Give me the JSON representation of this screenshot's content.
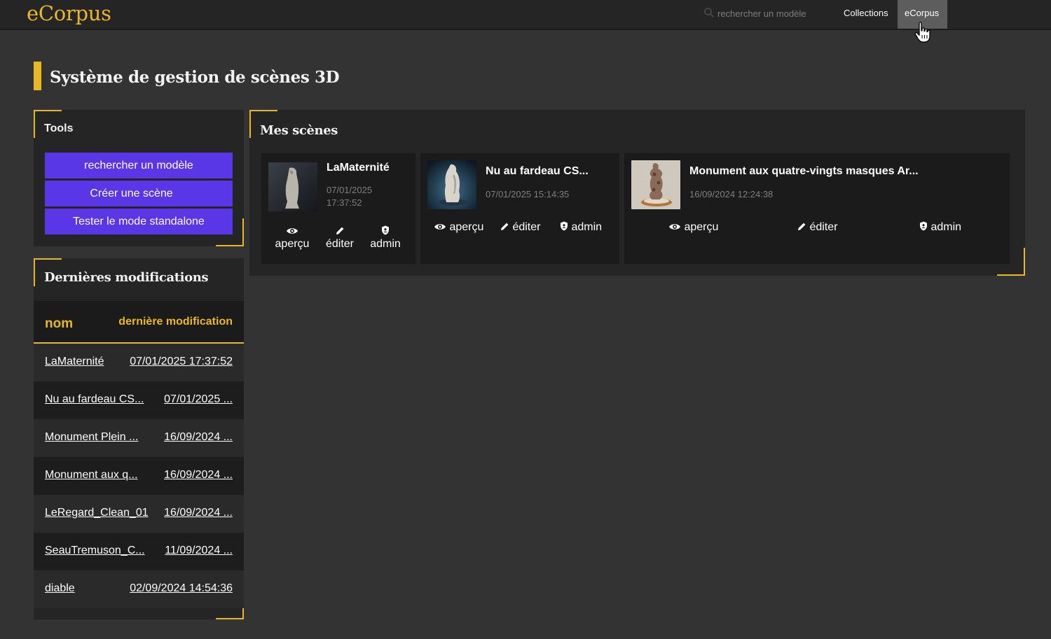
{
  "header": {
    "brand": "eCorpus",
    "search_placeholder": "rechercher un modèle",
    "nav": {
      "collections": "Collections",
      "ecorpus": "eCorpus"
    }
  },
  "page_title": "Système de gestion de scènes 3D",
  "tools": {
    "title": "Tools",
    "buttons": [
      "rechercher un modèle",
      "Créer une scène",
      "Tester le mode standalone"
    ]
  },
  "recent": {
    "title": "Dernières modifications",
    "col_name": "nom",
    "col_modified": "dernière modification",
    "rows": [
      {
        "name": "LaMaternité",
        "date": "07/01/2025 17:37:52"
      },
      {
        "name": "Nu au fardeau CS...",
        "date": "07/01/2025 ..."
      },
      {
        "name": "Monument Plein ...",
        "date": "16/09/2024 ..."
      },
      {
        "name": "Monument aux q...",
        "date": "16/09/2024 ..."
      },
      {
        "name": "LeRegard_Clean_01",
        "date": "16/09/2024 ..."
      },
      {
        "name": "SeauTremuson_C...",
        "date": "11/09/2024 ..."
      },
      {
        "name": "diable",
        "date": "02/09/2024 14:54:36"
      }
    ]
  },
  "scenes": {
    "title": "Mes scènes",
    "cards": [
      {
        "title": "LaMaternité",
        "date_line1": "07/01/2025",
        "date_line2": "17:37:52",
        "preview": "aperçu",
        "edit": "éditer",
        "admin": "admin"
      },
      {
        "title": "Nu au fardeau CS...",
        "date": "07/01/2025 15:14:35",
        "preview": "aperçu",
        "edit": "éditer",
        "admin": "admin"
      },
      {
        "title": "Monument aux quatre-vingts masques Ar...",
        "date": "16/09/2024 12:24:38",
        "preview": "aperçu",
        "edit": "éditer",
        "admin": "admin"
      }
    ]
  },
  "icons": {
    "search": "search-icon",
    "eye": "eye-icon",
    "pencil": "pencil-icon",
    "shield": "shield-icon",
    "cursor": "hand-cursor-icon"
  },
  "colors": {
    "accent": "#e8b826",
    "button": "#5937e6",
    "background": "#333333",
    "panel": "#252525"
  }
}
